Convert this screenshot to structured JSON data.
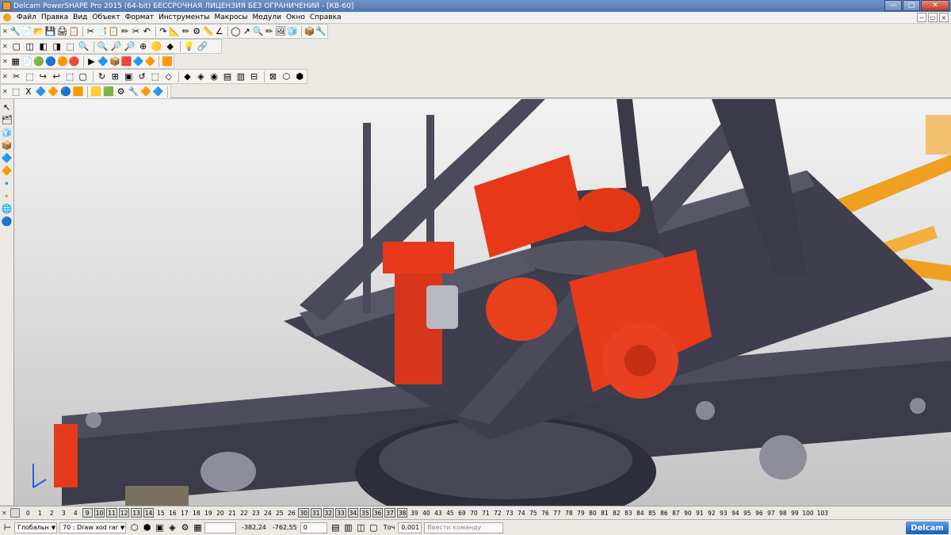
{
  "window": {
    "title": "Delcam PowerSHAPE Pro 2015 (64-bit) БЕССРОЧНАЯ ЛИЦЕНЗИЯ БЕЗ ОГРАНИЧЕНИЙ - [КВ-60]",
    "minimize": "—",
    "maximize": "□",
    "close": "✕"
  },
  "menu": {
    "items": [
      "Файл",
      "Правка",
      "Вид",
      "Объект",
      "Формат",
      "Инструменты",
      "Макросы",
      "Модули",
      "Окно",
      "Справка"
    ],
    "mdi_minimize": "−",
    "mdi_restore": "▭",
    "mdi_close": "×"
  },
  "toolbars": {
    "row1": [
      "🔧",
      "📄",
      "📂",
      "💾",
      "🖨",
      "📋",
      "✂",
      "📑",
      "📋",
      "✏",
      "✂",
      "↶",
      "↷",
      "📐",
      "✏",
      "⚙",
      "📏",
      "∠",
      "◯",
      "↗",
      "🔍",
      "✏",
      "🖼",
      "🧊",
      "📦",
      "🔧"
    ],
    "row2": [
      "▢",
      "◫",
      "◧",
      "◨",
      "⬚",
      "🔍",
      "🔍",
      "🔎",
      "🔎",
      "⊕",
      "🟡",
      "◆",
      "💡",
      "🔗"
    ],
    "row3": [
      "▦",
      "📄",
      "🟢",
      "🔵",
      "🟠",
      "🔴",
      "▶",
      "🔷",
      "📦",
      "🟥",
      "🔷",
      "🔶",
      "🟧"
    ],
    "row4": [
      "✂",
      "⬚",
      "↪",
      "↩",
      "⬚",
      "▢",
      "↻",
      "⊞",
      "▣",
      "↺",
      "⬚",
      "◇",
      "◆",
      "◈",
      "◉",
      "▤",
      "▥",
      "⊟",
      "⊠",
      "⬡",
      "⬢"
    ],
    "row5": [
      "⬚",
      "X",
      "🔷",
      "🔶",
      "🔵",
      "🟧",
      "🟨",
      "🟩",
      "⚙",
      "🔧",
      "🔶",
      "🔷"
    ]
  },
  "left_toolbar": {
    "items": [
      "↖",
      "🗂",
      "🧊",
      "📦",
      "🔷",
      "🔶",
      "🔹",
      "🔸",
      "🌐",
      "🔵"
    ]
  },
  "levels": {
    "numbers": [
      "0",
      "1",
      "2",
      "3",
      "4",
      "9",
      "10",
      "11",
      "12",
      "13",
      "14",
      "15",
      "16",
      "17",
      "18",
      "19",
      "20",
      "21",
      "22",
      "23",
      "24",
      "25",
      "26",
      "30",
      "31",
      "32",
      "33",
      "34",
      "35",
      "36",
      "37",
      "38",
      "39",
      "40",
      "43",
      "45",
      "69",
      "70",
      "71",
      "72",
      "73",
      "74",
      "75",
      "76",
      "77",
      "78",
      "79",
      "80",
      "81",
      "82",
      "83",
      "84",
      "85",
      "86",
      "87",
      "90",
      "91",
      "92",
      "93",
      "94",
      "95",
      "96",
      "97",
      "98",
      "99",
      "100",
      "103"
    ],
    "highlighted": [
      "9",
      "10",
      "11",
      "12",
      "13",
      "14",
      "30",
      "31",
      "32",
      "33",
      "34",
      "35",
      "36",
      "37",
      "38"
    ]
  },
  "status": {
    "workplane": "Глобальн",
    "object": "70 : Draw xod rar",
    "coord_x": "-382,24",
    "coord_y": "-762,55",
    "coord_z": "0",
    "tolerance_label": "Точ",
    "tolerance_value": "0,001",
    "command_placeholder": "Ввести команду",
    "brand": "Delcam"
  }
}
